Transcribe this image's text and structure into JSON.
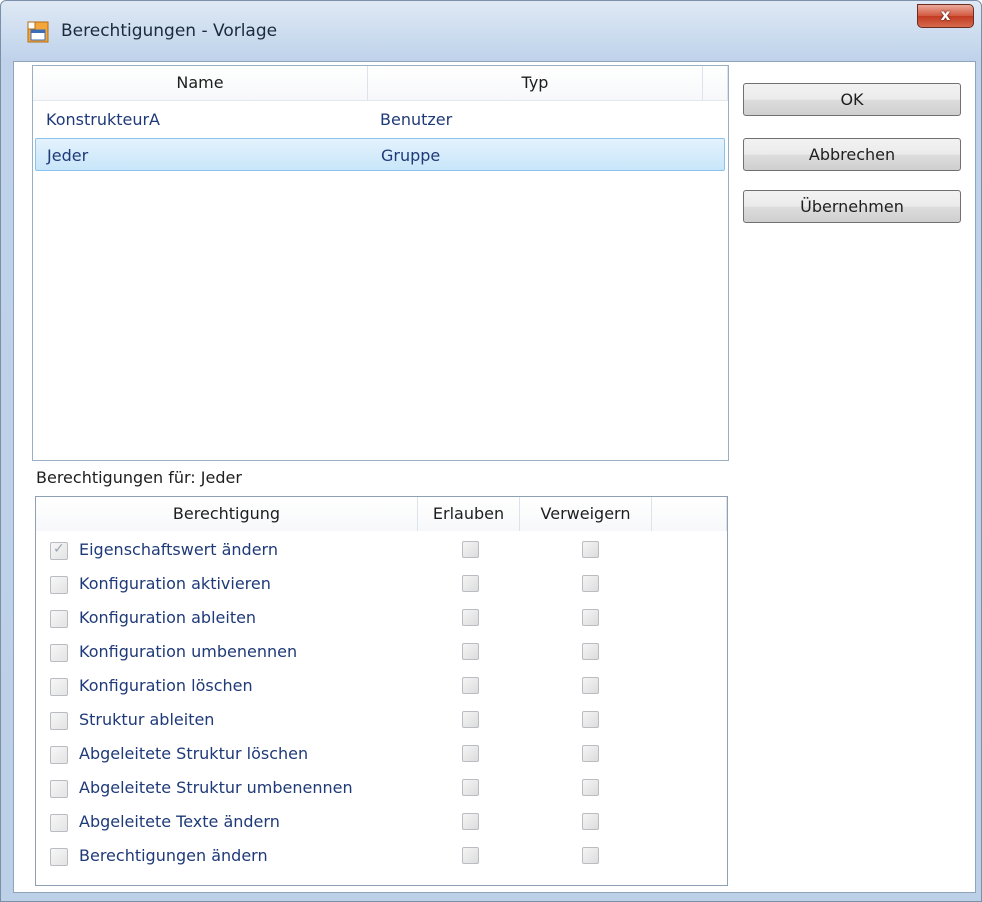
{
  "window": {
    "title": "Berechtigungen - Vorlage",
    "close_label": "x"
  },
  "user_list": {
    "columns": [
      "Name",
      "Typ"
    ],
    "rows": [
      {
        "name": "KonstrukteurA",
        "type": "Benutzer",
        "selected": false
      },
      {
        "name": "Jeder",
        "type": "Gruppe",
        "selected": true
      }
    ]
  },
  "buttons": {
    "ok": "OK",
    "cancel": "Abbrechen",
    "apply": "Übernehmen"
  },
  "permissions": {
    "label": "Berechtigungen für:  Jeder",
    "columns": [
      "Berechtigung",
      "Erlauben",
      "Verweigern"
    ],
    "rows": [
      {
        "name": "Eigenschaftswert ändern",
        "checked": true
      },
      {
        "name": "Konfiguration aktivieren",
        "checked": false
      },
      {
        "name": "Konfiguration ableiten",
        "checked": false
      },
      {
        "name": "Konfiguration umbenennen",
        "checked": false
      },
      {
        "name": "Konfiguration löschen",
        "checked": false
      },
      {
        "name": "Struktur ableiten",
        "checked": false
      },
      {
        "name": "Abgeleitete Struktur löschen",
        "checked": false
      },
      {
        "name": "Abgeleitete Struktur umbenennen",
        "checked": false
      },
      {
        "name": "Abgeleitete Texte ändern",
        "checked": false
      },
      {
        "name": "Berechtigungen ändern",
        "checked": false
      }
    ]
  }
}
